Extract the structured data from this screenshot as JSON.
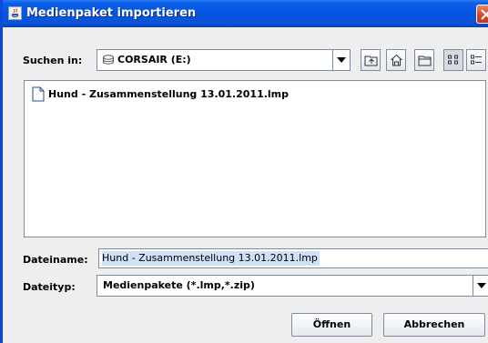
{
  "window": {
    "title": "Medienpaket importieren",
    "colors": {
      "titlebar": "#0554e0",
      "close": "#d8472a",
      "background": "#eeeeee"
    }
  },
  "lookin": {
    "label": "Suchen in:",
    "value": "CORSAIR (E:)",
    "drive_icon": "drive-icon"
  },
  "toolbar": {
    "buttons": [
      "up-folder-icon",
      "home-icon",
      "new-folder-icon",
      "list-view-icon",
      "details-view-icon"
    ]
  },
  "files": [
    {
      "name": "Hund - Zusammenstellung 13.01.2011.lmp",
      "icon": "file-icon"
    }
  ],
  "filename": {
    "label": "Dateiname:",
    "value": "Hund - Zusammenstellung 13.01.2011.lmp"
  },
  "filetype": {
    "label": "Dateityp:",
    "value": "Medienpakete (*.lmp,*.zip)"
  },
  "buttons": {
    "open": "Öffnen",
    "cancel": "Abbrechen"
  }
}
